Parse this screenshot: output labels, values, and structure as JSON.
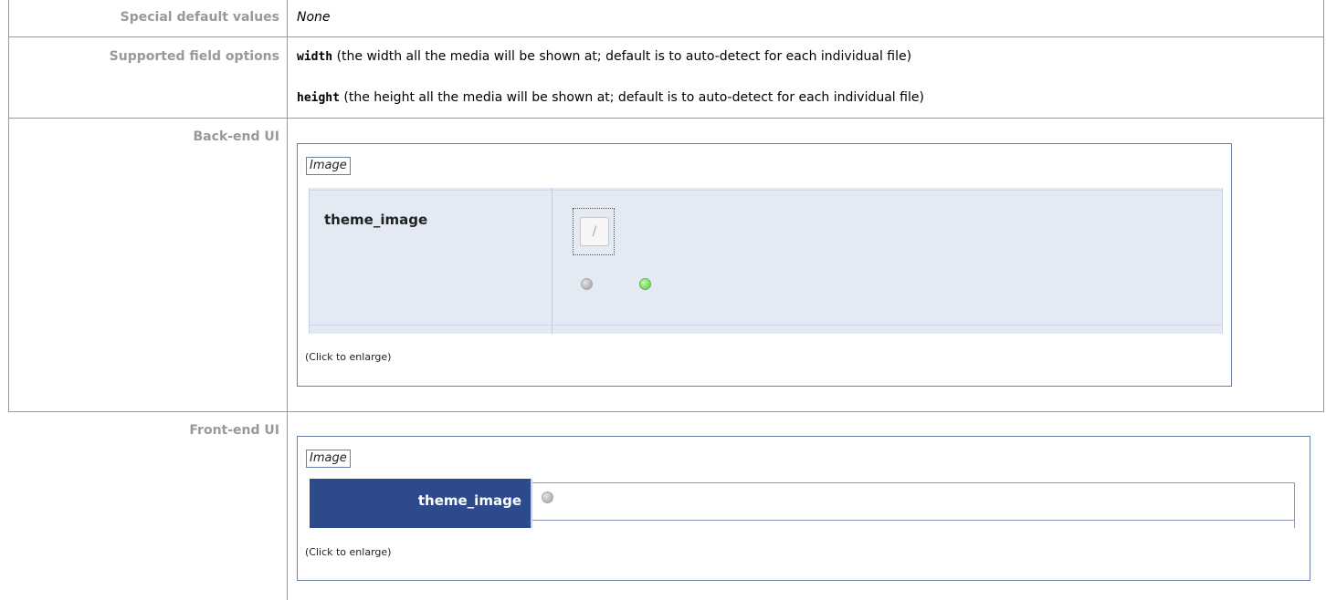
{
  "rows": {
    "special_defaults": {
      "label": "Special default values",
      "value": "None"
    },
    "field_options": {
      "label": "Supported field options",
      "options": [
        {
          "name": "width",
          "desc": "(the width all the media will be shown at; default is to auto-detect for each individual file)"
        },
        {
          "name": "height",
          "desc": "(the height all the media will be shown at; default is to auto-detect for each individual file)"
        }
      ]
    },
    "backend_ui": {
      "label": "Back-end UI",
      "image_tag": "Image",
      "field_name": "theme_image",
      "caption": "(Click to enlarge)"
    },
    "frontend_ui": {
      "label": "Front-end UI",
      "image_tag": "Image",
      "field_name": "theme_image",
      "caption": "(Click to enlarge)"
    }
  },
  "colors": {
    "label_text": "#999999",
    "backend_panel": "#e4eaf3",
    "frontend_header": "#2c4a8c",
    "border": "#6b7fa3",
    "status_green": "#4cc93a",
    "status_grey": "#9a9a9a"
  }
}
